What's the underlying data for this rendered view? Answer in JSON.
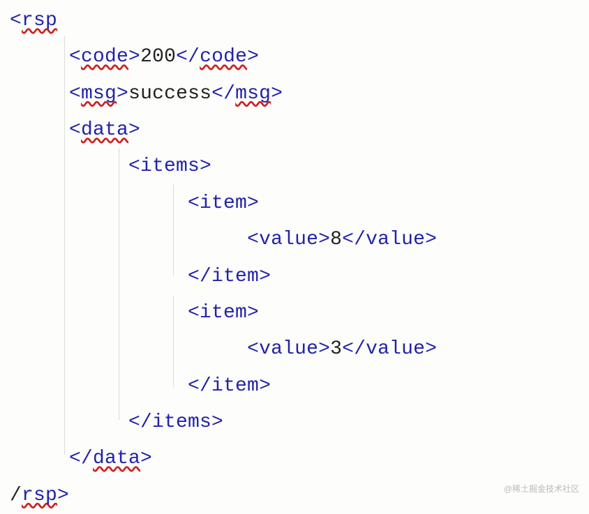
{
  "code": {
    "tokens": [
      {
        "indent": 0,
        "parts": [
          {
            "class": "tag",
            "text": "<"
          },
          {
            "class": "err",
            "text": "rsp"
          }
        ]
      },
      {
        "indent": 1,
        "parts": [
          {
            "class": "tag",
            "text": "<"
          },
          {
            "class": "err",
            "text": "code"
          },
          {
            "class": "tag",
            "text": ">"
          },
          {
            "class": "txt",
            "text": "200"
          },
          {
            "class": "tag",
            "text": "</"
          },
          {
            "class": "err",
            "text": "code"
          },
          {
            "class": "tag",
            "text": ">"
          }
        ]
      },
      {
        "indent": 1,
        "parts": [
          {
            "class": "tag",
            "text": "<"
          },
          {
            "class": "err",
            "text": "msg"
          },
          {
            "class": "tag",
            "text": ">"
          },
          {
            "class": "txt",
            "text": "success"
          },
          {
            "class": "tag",
            "text": "</"
          },
          {
            "class": "err",
            "text": "msg"
          },
          {
            "class": "tag",
            "text": ">"
          }
        ]
      },
      {
        "indent": 1,
        "parts": [
          {
            "class": "tag",
            "text": "<"
          },
          {
            "class": "err",
            "text": "data"
          },
          {
            "class": "tag",
            "text": ">"
          }
        ]
      },
      {
        "indent": 2,
        "parts": [
          {
            "class": "tag",
            "text": "<items>"
          }
        ]
      },
      {
        "indent": 3,
        "parts": [
          {
            "class": "tag",
            "text": "<item>"
          }
        ]
      },
      {
        "indent": 4,
        "parts": [
          {
            "class": "tag",
            "text": "<value>"
          },
          {
            "class": "txt",
            "text": "8"
          },
          {
            "class": "tag",
            "text": "</value>"
          }
        ]
      },
      {
        "indent": 3,
        "parts": [
          {
            "class": "tag",
            "text": "</item>"
          }
        ]
      },
      {
        "indent": 3,
        "parts": [
          {
            "class": "tag",
            "text": "<item>"
          }
        ]
      },
      {
        "indent": 4,
        "parts": [
          {
            "class": "tag",
            "text": "<value>"
          },
          {
            "class": "txt",
            "text": "3"
          },
          {
            "class": "tag",
            "text": "</value>"
          }
        ]
      },
      {
        "indent": 3,
        "parts": [
          {
            "class": "tag",
            "text": "</item>"
          }
        ]
      },
      {
        "indent": 2,
        "parts": [
          {
            "class": "tag",
            "text": "</items>"
          }
        ]
      },
      {
        "indent": 1,
        "parts": [
          {
            "class": "tag",
            "text": "</"
          },
          {
            "class": "err",
            "text": "data"
          },
          {
            "class": "tag",
            "text": ">"
          }
        ]
      },
      {
        "indent": 0,
        "parts": [
          {
            "class": "txt",
            "text": "/"
          },
          {
            "class": "err",
            "text": "rsp"
          },
          {
            "class": "tag",
            "text": ">"
          }
        ]
      }
    ]
  },
  "watermark": "@稀土掘金技术社区",
  "indent_str": "     "
}
